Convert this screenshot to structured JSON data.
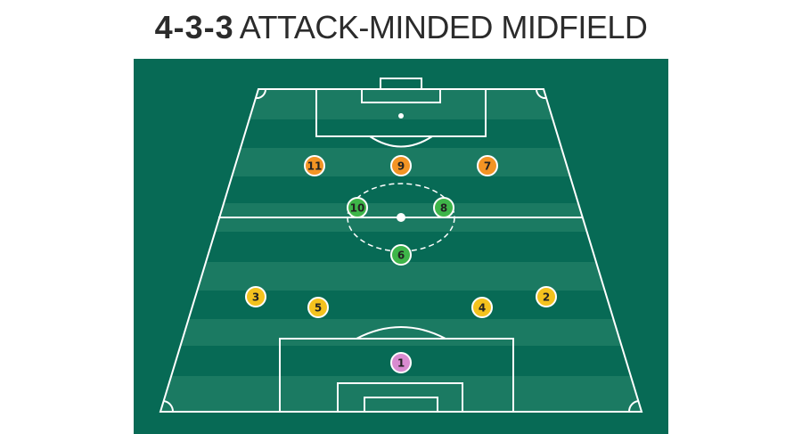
{
  "title": {
    "bold": "4-3-3",
    "rest": "ATTACK-MINDED MIDFIELD"
  },
  "colors": {
    "background": "#076a55",
    "stripe_light": "#1b7a62",
    "stripe_dark": "#0d6d57",
    "lines": "#ffffff",
    "forwards": "#f39424",
    "midfielders": "#3eb549",
    "defenders": "#f4c21e",
    "goalkeeper": "#d98bd0"
  },
  "players": [
    {
      "number": "11",
      "role": "forwards"
    },
    {
      "number": "9",
      "role": "forwards"
    },
    {
      "number": "7",
      "role": "forwards"
    },
    {
      "number": "10",
      "role": "midfielders"
    },
    {
      "number": "8",
      "role": "midfielders"
    },
    {
      "number": "6",
      "role": "midfielders"
    },
    {
      "number": "3",
      "role": "defenders"
    },
    {
      "number": "5",
      "role": "defenders"
    },
    {
      "number": "4",
      "role": "defenders"
    },
    {
      "number": "2",
      "role": "defenders"
    },
    {
      "number": "1",
      "role": "goalkeeper"
    }
  ]
}
